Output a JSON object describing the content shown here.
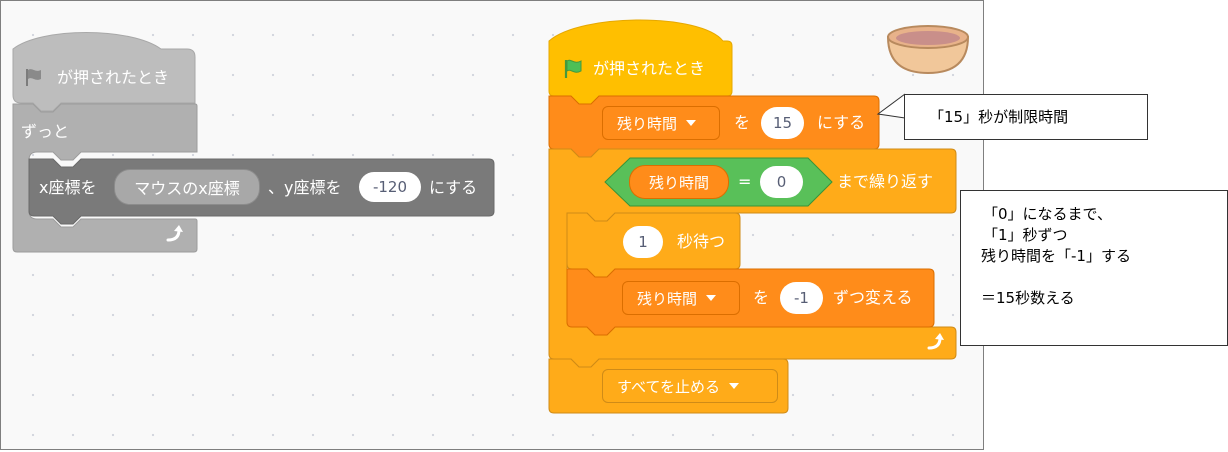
{
  "script_left": {
    "hat_label": "が押されたとき",
    "forever_label": "ずっと",
    "goto": {
      "x_label": "x座標を",
      "reporter": "マウスのx座標",
      "y_label": "、y座標を",
      "y_value": "-120",
      "suffix": "にする"
    }
  },
  "script_right": {
    "hat_label": "が押されたとき",
    "set_var": {
      "variable": "残り時間",
      "to_label": "を",
      "value": "15",
      "suffix": "にする"
    },
    "repeat_until": {
      "variable": "残り時間",
      "operator": "=",
      "compare_value": "0",
      "suffix": "まで繰り返す"
    },
    "wait": {
      "value": "1",
      "suffix": "秒待つ"
    },
    "change_var": {
      "variable": "残り時間",
      "by_label": "を",
      "value": "-1",
      "suffix": "ずつ変える"
    },
    "stop": {
      "option": "すべてを止める"
    }
  },
  "annotations": {
    "callout_1": "「15」秒が制限時間",
    "callout_2": [
      "「0」になるまで、",
      "「1」秒ずつ",
      "残り時間を「-1」する",
      "",
      "＝15秒数える"
    ]
  },
  "colors": {
    "events": "#ffbf00",
    "control": "#ffab19",
    "variables": "#ff8c1a",
    "operators": "#59c059",
    "inactive": "#a7a7a7"
  },
  "icons": [
    "green-flag-icon",
    "gray-flag-icon",
    "loop-arrow-icon",
    "dropdown-caret-icon",
    "sprite-thumbnail-icon"
  ]
}
